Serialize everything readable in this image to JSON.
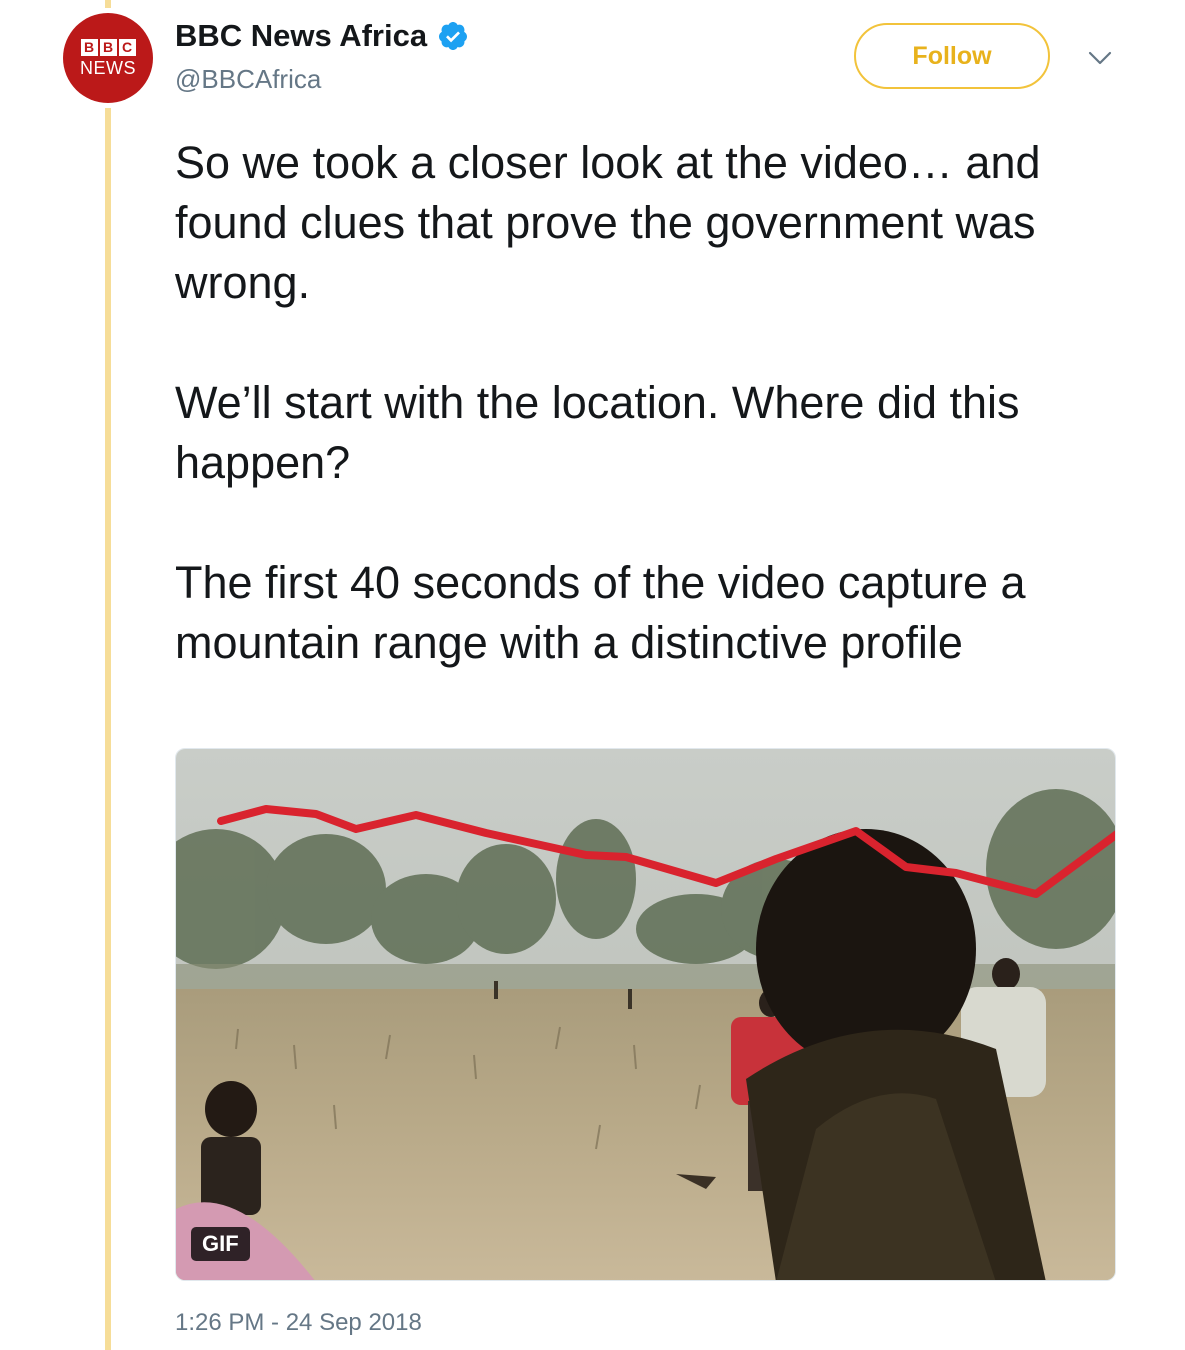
{
  "account": {
    "name": "BBC News Africa",
    "handle": "@BBCAfrica",
    "verified": true,
    "avatar_logo": [
      "B",
      "B",
      "C"
    ],
    "avatar_text": "NEWS"
  },
  "follow_button": {
    "label": "Follow"
  },
  "tweet": {
    "paragraphs": [
      "So we took a closer look at the video… and found clues that prove the government was wrong.",
      "We’ll start with the location. Where did this happen?",
      "The first 40 seconds of the video capture a mountain range with a distinctive profile"
    ],
    "media_badge": "GIF",
    "timestamp": "1:26 PM - 24 Sep 2018"
  },
  "colors": {
    "accent": "#f2c33b",
    "thread_line": "#f6dd98",
    "bbc_red": "#bb1919",
    "verified_blue": "#1da1f2",
    "profile_line": "#d9232e"
  },
  "icons": {
    "verified": "verified-badge-icon",
    "more": "chevron-down-icon"
  }
}
